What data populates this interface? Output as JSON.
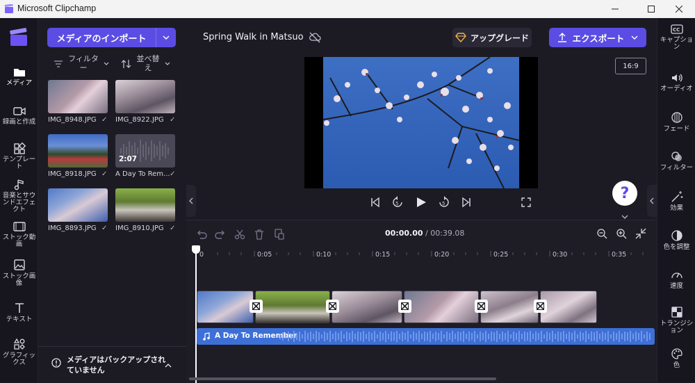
{
  "window": {
    "title": "Microsoft Clipchamp"
  },
  "left_nav": {
    "items": [
      {
        "label": "メディア",
        "icon": "folder-icon",
        "active": true
      },
      {
        "label": "録画と作成",
        "icon": "camera-icon"
      },
      {
        "label": "テンプレート",
        "icon": "template-icon"
      },
      {
        "label": "音楽とサウンドエフェクト",
        "icon": "music-icon"
      },
      {
        "label": "ストック動画",
        "icon": "film-icon"
      },
      {
        "label": "ストック画像",
        "icon": "image-icon"
      },
      {
        "label": "テキスト",
        "icon": "text-icon"
      },
      {
        "label": "グラフィックス",
        "icon": "shapes-icon"
      }
    ]
  },
  "media_panel": {
    "import_label": "メディアのインポート",
    "filter_label": "フィルター",
    "sort_label": "並べ替え",
    "items": [
      {
        "name": "IMG_8948.JPG",
        "checked": true
      },
      {
        "name": "IMG_8922.JPG",
        "checked": true
      },
      {
        "name": "IMG_8918.JPG",
        "checked": true
      },
      {
        "name": "A Day To Rem...",
        "checked": true,
        "duration": "2:07"
      },
      {
        "name": "IMG_8893.JPG",
        "checked": true
      },
      {
        "name": "IMG_8910.JPG",
        "checked": true
      }
    ],
    "backup_notice": "メディアはバックアップされていません"
  },
  "header": {
    "project_title": "Spring Walk in Matsuo",
    "upgrade_label": "アップグレード",
    "export_label": "エクスポート",
    "aspect_ratio": "16:9"
  },
  "timeline": {
    "current_time": "00:00.00",
    "total_time": "/ 00:39.08",
    "ticks": [
      "0",
      "0:05",
      "0:10",
      "0:15",
      "0:20",
      "0:25",
      "0:30",
      "0:35"
    ],
    "audio_clip": "A Day To Remember"
  },
  "right_nav": {
    "items": [
      {
        "label": "キャプション",
        "icon": "captions-icon"
      },
      {
        "label": "オーディオ",
        "icon": "speaker-icon"
      },
      {
        "label": "フェード",
        "icon": "fade-icon"
      },
      {
        "label": "フィルター",
        "icon": "filter-icon"
      },
      {
        "label": "効果",
        "icon": "effects-wand-icon"
      },
      {
        "label": "色を調整",
        "icon": "color-adjust-icon"
      },
      {
        "label": "速度",
        "icon": "speed-gauge-icon"
      },
      {
        "label": "トランジション",
        "icon": "transition-icon"
      },
      {
        "label": "色",
        "icon": "palette-icon"
      }
    ]
  },
  "colors": {
    "accent": "#5b4de3",
    "audio_track": "#3d6fd6",
    "background": "#1c1b24"
  }
}
